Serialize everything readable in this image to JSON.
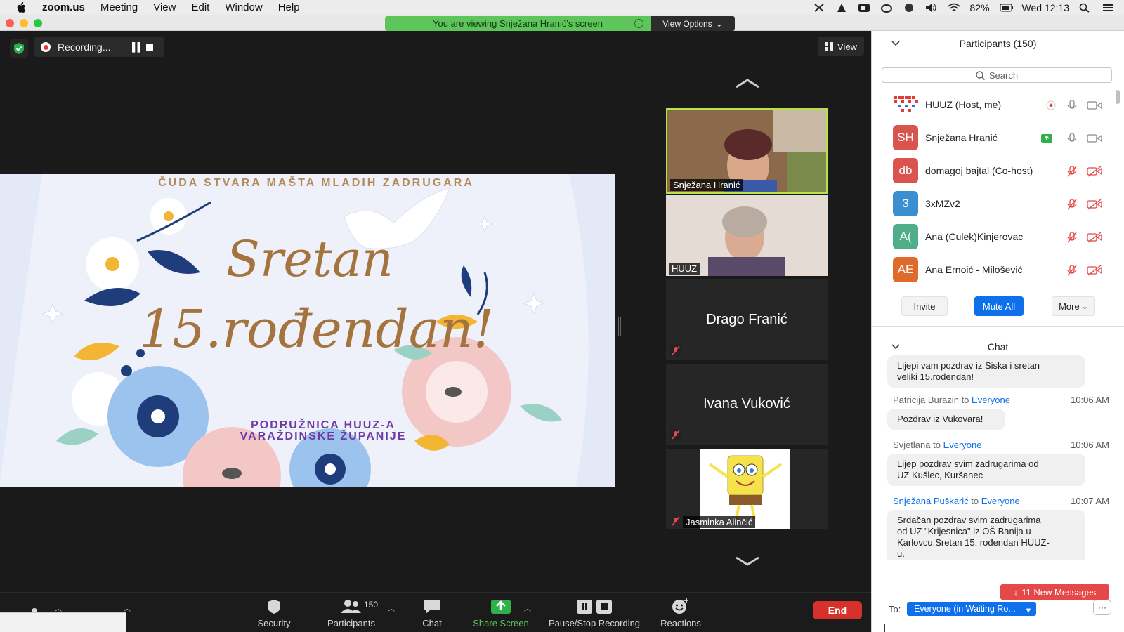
{
  "menubar": {
    "app_name": "zoom.us",
    "items": [
      "Meeting",
      "View",
      "Edit",
      "Window",
      "Help"
    ],
    "battery": "82%",
    "clock": "Wed 12:13"
  },
  "banner": {
    "viewing_text": "You are viewing Snježana Hranić's screen",
    "view_options": "View Options"
  },
  "stage": {
    "recording_label": "Recording...",
    "view_label": "View"
  },
  "slide": {
    "top_line": "ČUDA STVARA MAŠTA MLADIH ZADRUGARA",
    "line1": "Sretan",
    "line2": "15.rođendan!",
    "sub1": "PODRUŽNICA HUUZ-A",
    "sub2": "VARAŽDINSKE ŽUPANIJE"
  },
  "thumbnails": [
    {
      "name": "Snježana Hranić",
      "active": true
    },
    {
      "name": "HUUZ"
    },
    {
      "name": "Drago Franić"
    },
    {
      "name": "Ivana Vuković"
    },
    {
      "name": "Jasminka Alinčić"
    }
  ],
  "toolbar": {
    "security": "Security",
    "participants": "Participants",
    "participants_count": "150",
    "chat": "Chat",
    "share_screen": "Share Screen",
    "pause_stop": "Pause/Stop Recording",
    "reactions": "Reactions",
    "end": "End"
  },
  "participants_panel": {
    "title": "Participants (150)",
    "search_placeholder": "Search",
    "people": [
      {
        "initials": "",
        "name": "HUUZ (Host, me)",
        "color": "#ffffff"
      },
      {
        "initials": "SH",
        "name": "Snježana Hranić",
        "color": "#d9534f"
      },
      {
        "initials": "db",
        "name": "domagoj bajtal (Co-host)",
        "color": "#d9534f"
      },
      {
        "initials": "3",
        "name": "3xMZv2",
        "color": "#3a8fd1"
      },
      {
        "initials": "A(",
        "name": "Ana (Culek)Kinjerovac",
        "color": "#4fae8a"
      },
      {
        "initials": "AE",
        "name": "Ana Ernoić - Milošević",
        "color": "#e06a2a"
      }
    ],
    "invite": "Invite",
    "mute_all": "Mute All",
    "more": "More"
  },
  "chat": {
    "title": "Chat",
    "messages": [
      {
        "text1": "Lijepi vam pozdrav iz Siska i sretan",
        "text2": "veliki 15.rodendan!"
      },
      {
        "sender": "Patricija Burazin",
        "to": "to",
        "target": "Everyone",
        "time": "10:06 AM",
        "text": "Pozdrav iz Vukovara!"
      },
      {
        "sender": "Svjetlana",
        "to": "to",
        "target": "Everyone",
        "time": "10:06 AM",
        "text1": "Lijep pozdrav svim zadrugarima od",
        "text2": "UZ Kušlec, Kuršanec"
      },
      {
        "sender": "Snježana Puškarić",
        "to": "to",
        "target": "Everyone",
        "time": "10:07 AM",
        "text1": "Srdačan pozdrav svim zadrugarima",
        "text2": "od UZ \"Krijesnica\" iz OŠ Banija u",
        "text3": "Karlovcu.Sretan 15. rođendan HUUZ-",
        "text4": "u."
      }
    ],
    "new_messages": "11 New Messages",
    "to_label": "To:",
    "to_value": "Everyone (in Waiting Ro..."
  },
  "colors": {
    "banner_green": "#5ec55a",
    "accent_blue": "#0e71eb",
    "end_red": "#d6322b",
    "active_border": "#b8e24a"
  }
}
